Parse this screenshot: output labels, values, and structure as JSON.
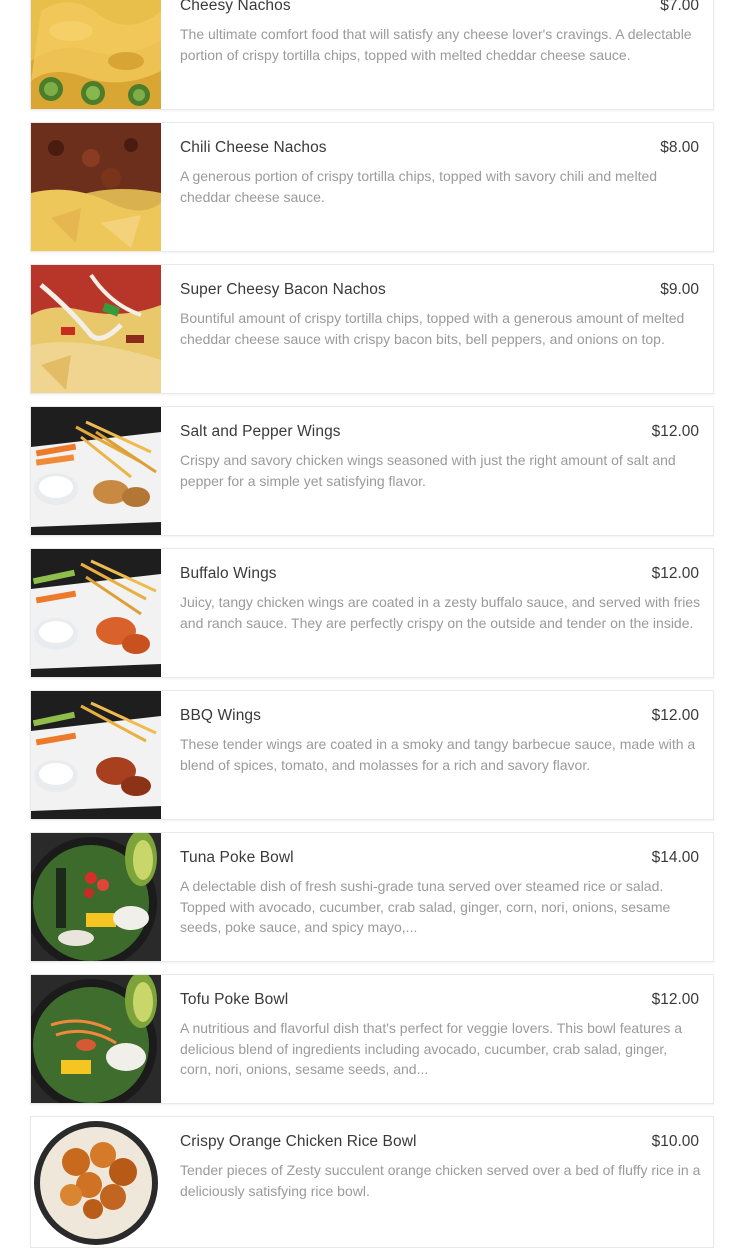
{
  "menu": {
    "items": [
      {
        "name": "Cheesy Nachos",
        "price": "$7.00",
        "description": "The ultimate comfort food that will satisfy any cheese lover's cravings. A delectable portion of crispy tortilla chips, topped with melted cheddar cheese sauce.",
        "image": "cheesy-nachos-photo"
      },
      {
        "name": "Chili Cheese Nachos",
        "price": "$8.00",
        "description": "A generous portion of crispy tortilla chips, topped with savory chili and melted cheddar cheese sauce.",
        "image": "chili-cheese-nachos-photo"
      },
      {
        "name": "Super Cheesy Bacon Nachos",
        "price": "$9.00",
        "description": "Bountiful amount of crispy tortilla chips, topped with a generous amount of melted cheddar cheese sauce with crispy bacon bits, bell peppers, and onions on top.",
        "image": "bacon-nachos-photo"
      },
      {
        "name": "Salt and Pepper Wings",
        "price": "$12.00",
        "description": "Crispy and savory chicken wings seasoned with just the right amount of salt and pepper for a simple yet satisfying flavor.",
        "image": "salt-pepper-wings-photo"
      },
      {
        "name": "Buffalo Wings",
        "price": "$12.00",
        "description": "Juicy, tangy chicken wings are coated in a zesty buffalo sauce, and served with fries and ranch sauce. They are perfectly crispy on the outside and tender on the inside.",
        "image": "buffalo-wings-photo"
      },
      {
        "name": "BBQ Wings",
        "price": "$12.00",
        "description": "These tender wings are coated in a smoky and tangy barbecue sauce, made with a blend of spices, tomato, and molasses for a rich and savory flavor.",
        "image": "bbq-wings-photo"
      },
      {
        "name": "Tuna Poke Bowl",
        "price": "$14.00",
        "description": "A delectable dish of fresh sushi-grade tuna served over steamed rice or salad. Topped with avocado, cucumber, crab salad, ginger, corn, nori, onions, sesame seeds, poke sauce, and spicy mayo,...",
        "image": "tuna-poke-bowl-photo"
      },
      {
        "name": "Tofu Poke Bowl",
        "price": "$12.00",
        "description": "A nutritious and flavorful dish that's perfect for veggie lovers. This bowl features a delicious blend of ingredients including avocado, cucumber, crab salad, ginger, corn, nori, onions, sesame seeds, and...",
        "image": "tofu-poke-bowl-photo"
      },
      {
        "name": "Crispy Orange Chicken Rice Bowl",
        "price": "$10.00",
        "description": "Tender pieces of Zesty succulent orange chicken served over a bed of fluffy rice in a deliciously satisfying rice bowl.",
        "image": "orange-chicken-bowl-photo"
      }
    ]
  }
}
